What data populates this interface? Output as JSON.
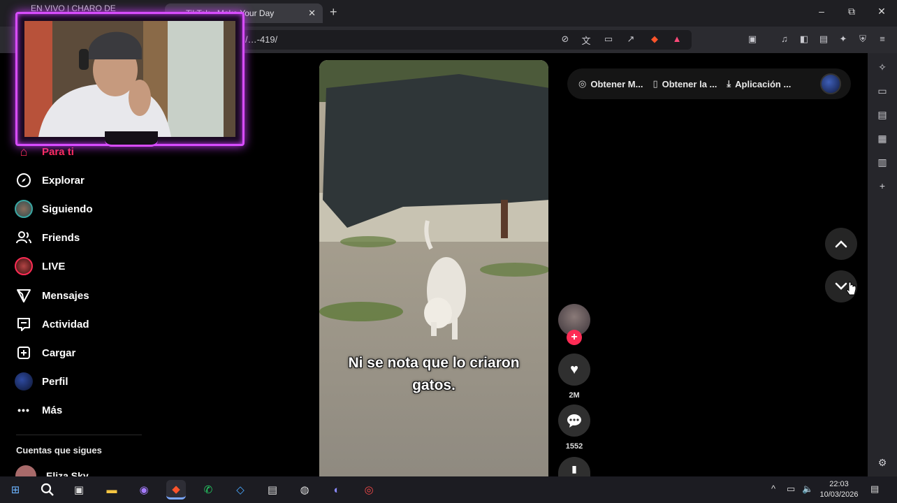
{
  "browser": {
    "tabs": [
      {
        "title": "EN VIVO | CHARO DE REGGAETON",
        "active": false
      },
      {
        "title": "TikTok - Make Your Day",
        "active": true
      }
    ],
    "url": "…/…-419/",
    "window_controls": {
      "minimize": "–",
      "maximize": "⧉",
      "close": "✕"
    }
  },
  "sidebar": {
    "items": [
      {
        "label": "Para ti",
        "icon": "home-icon",
        "active": true
      },
      {
        "label": "Explorar",
        "icon": "compass-icon"
      },
      {
        "label": "Siguiendo",
        "icon": "following-avatar-icon"
      },
      {
        "label": "Friends",
        "icon": "friends-icon"
      },
      {
        "label": "LIVE",
        "icon": "live-avatar-icon"
      },
      {
        "label": "Mensajes",
        "icon": "send-icon"
      },
      {
        "label": "Actividad",
        "icon": "inbox-icon"
      },
      {
        "label": "Cargar",
        "icon": "plus-square-icon"
      },
      {
        "label": "Perfil",
        "icon": "profile-avatar-icon"
      },
      {
        "label": "Más",
        "icon": "more-icon"
      }
    ],
    "following_title": "Cuentas que sigues",
    "followed_accounts": [
      {
        "name": "Eliza Sky"
      }
    ]
  },
  "video": {
    "caption_line1": "Ni se nota que lo criaron",
    "caption_line2": "gatos."
  },
  "actions": {
    "likes": "2M",
    "comments": "1552"
  },
  "top_actions": {
    "get_coins": "Obtener M...",
    "get_app": "Obtener la ...",
    "desktop_app": "Aplicación ..."
  },
  "taskbar": {
    "time": "22:03",
    "date": "10/03/2026"
  },
  "colors": {
    "accent": "#fe2c55",
    "webcam_frame": "#d84cff"
  }
}
